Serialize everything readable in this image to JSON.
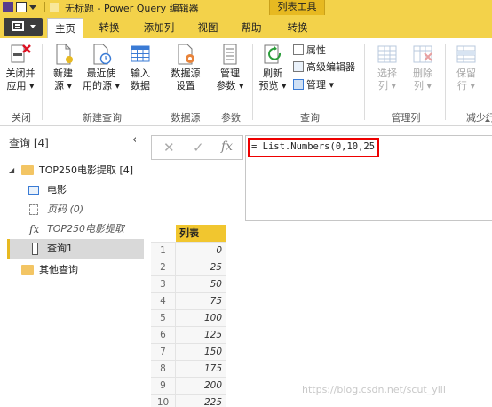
{
  "titlebar": {
    "title": "无标题 - Power Query 编辑器",
    "context_tools": "列表工具"
  },
  "tabs": [
    {
      "label": "主页",
      "active": true
    },
    {
      "label": "转换",
      "active": false
    },
    {
      "label": "添加列",
      "active": false
    },
    {
      "label": "视图",
      "active": false
    },
    {
      "label": "帮助",
      "active": false
    },
    {
      "label": "转换",
      "active": false
    }
  ],
  "ribbon": {
    "close_apply": {
      "line1": "关闭并",
      "line2": "应用 ▾"
    },
    "new_source": {
      "line1": "新建",
      "line2": "源 ▾"
    },
    "recent_sources": {
      "line1": "最近使",
      "line2": "用的源 ▾"
    },
    "enter_data": {
      "line1": "输入",
      "line2": "数据"
    },
    "data_source_settings": {
      "line1": "数据源",
      "line2": "设置"
    },
    "manage_params": {
      "line1": "管理",
      "line2": "参数 ▾"
    },
    "refresh_preview": {
      "line1": "刷新",
      "line2": "预览 ▾"
    },
    "properties": "属性",
    "advanced_editor": "高级编辑器",
    "manage": "管理 ▾",
    "choose_columns": {
      "line1": "选择",
      "line2": "列 ▾"
    },
    "remove_columns": {
      "line1": "删除",
      "line2": "列 ▾"
    },
    "keep_rows": {
      "line1": "保留",
      "line2": "行 ▾"
    },
    "groups": {
      "close": "关闭",
      "new_query": "新建查询",
      "data_sources": "数据源",
      "parameters": "参数",
      "query": "查询",
      "manage_columns": "管理列",
      "reduce_rows": "减少行"
    }
  },
  "query_pane": {
    "header": "查询 [4]",
    "group_name": "TOP250电影提取 [4]",
    "items": [
      {
        "label": "电影"
      },
      {
        "label": "页码 (0)"
      },
      {
        "label": "TOP250电影提取"
      },
      {
        "label": "查询1"
      }
    ],
    "other_group": "其他查询"
  },
  "formula_bar": {
    "cancel_glyph": "✕",
    "check_glyph": "✓",
    "fx_glyph": "fx",
    "formula": "= List.Numbers(0,10,25)"
  },
  "grid": {
    "column_header": "列表",
    "rows": [
      {
        "n": "1",
        "v": "0"
      },
      {
        "n": "2",
        "v": "25"
      },
      {
        "n": "3",
        "v": "50"
      },
      {
        "n": "4",
        "v": "75"
      },
      {
        "n": "5",
        "v": "100"
      },
      {
        "n": "6",
        "v": "125"
      },
      {
        "n": "7",
        "v": "150"
      },
      {
        "n": "8",
        "v": "175"
      },
      {
        "n": "9",
        "v": "200"
      },
      {
        "n": "10",
        "v": "225"
      }
    ]
  },
  "watermark": "https://blog.csdn.net/scut_yili",
  "colors": {
    "accent": "#f3d24a",
    "context_tab": "#e7b921",
    "highlight_box": "#ee0000"
  }
}
